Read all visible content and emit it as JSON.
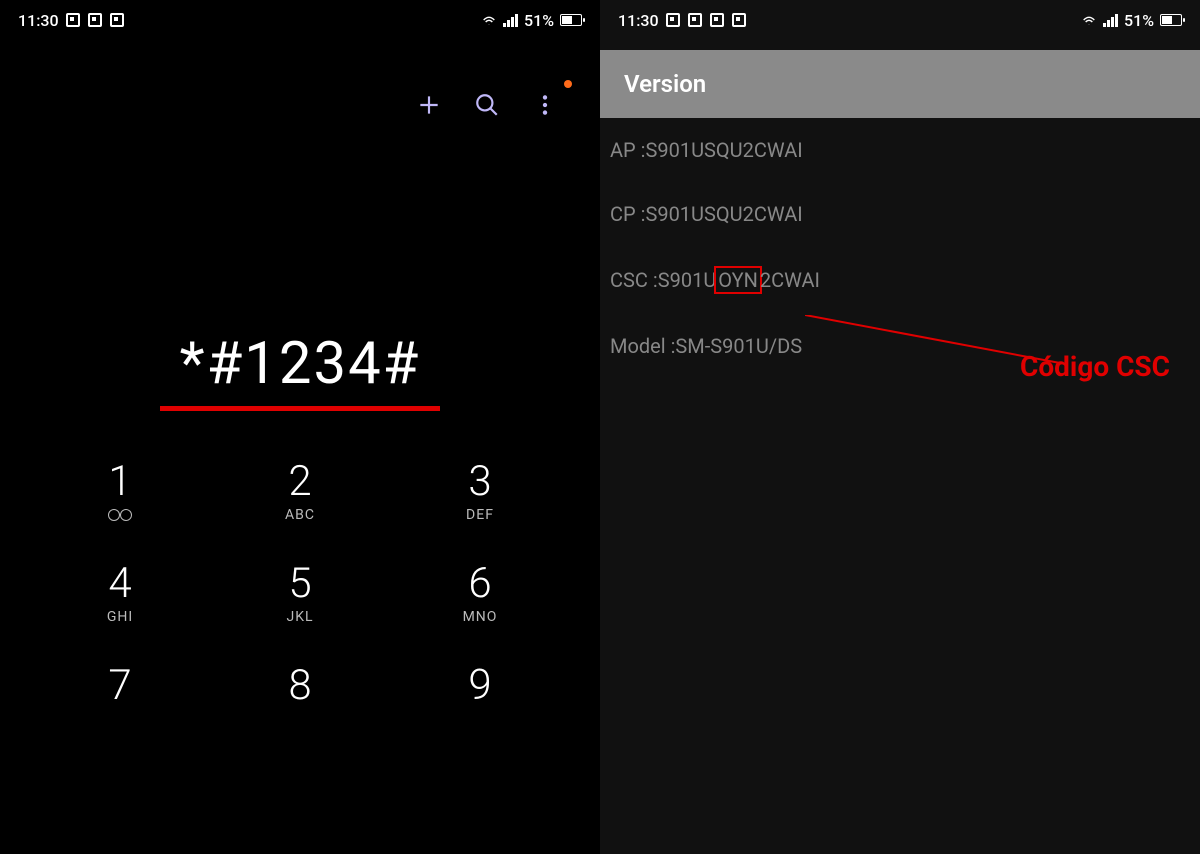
{
  "left": {
    "status": {
      "time": "11:30",
      "battery": "51%"
    },
    "dialed": "*#1234#",
    "keys": [
      {
        "digit": "1",
        "letters": ""
      },
      {
        "digit": "2",
        "letters": "ABC"
      },
      {
        "digit": "3",
        "letters": "DEF"
      },
      {
        "digit": "4",
        "letters": "GHI"
      },
      {
        "digit": "5",
        "letters": "JKL"
      },
      {
        "digit": "6",
        "letters": "MNO"
      },
      {
        "digit": "7",
        "letters": ""
      },
      {
        "digit": "8",
        "letters": ""
      },
      {
        "digit": "9",
        "letters": ""
      }
    ]
  },
  "right": {
    "status": {
      "time": "11:30",
      "battery": "51%"
    },
    "header": "Version",
    "ap_label": "AP : ",
    "ap_value": "S901USQU2CWAI",
    "cp_label": "CP : ",
    "cp_value": "S901USQU2CWAI",
    "csc_label": "CSC : ",
    "csc_pre": "S901U",
    "csc_code": "OYN",
    "csc_post": "2CWAI",
    "model_label": "Model :",
    "model_value": "SM-S901U/DS",
    "annotation": "Código CSC"
  }
}
